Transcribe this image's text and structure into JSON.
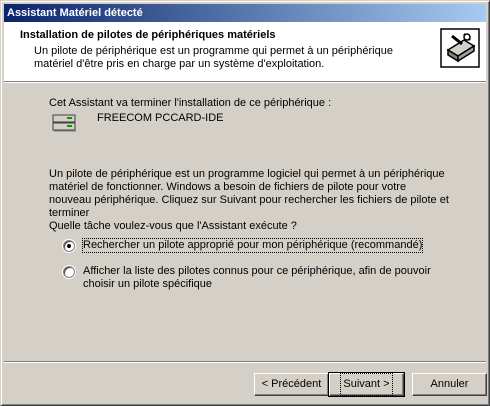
{
  "window": {
    "title": "Assistant Matériel détecté"
  },
  "header": {
    "title": "Installation de pilotes de périphériques matériels",
    "subtitle": "Un pilote de périphérique est un programme qui permet à un périphérique matériel d'être pris en charge par un système d'exploitation.",
    "icon": "hardware-wizard-icon"
  },
  "body": {
    "intro": "Cet Assistant va terminer l'installation de ce périphérique :",
    "device_name": "FREECOM PCCARD-IDE",
    "device_icon": "drive-card-icon",
    "description": "Un pilote de périphérique est un programme logiciel qui permet à un périphérique matériel de fonctionner. Windows a besoin de fichiers de pilote pour votre nouveau périphérique. Cliquez sur Suivant pour rechercher les fichiers de pilote et terminer",
    "question": "Quelle tâche voulez-vous que l'Assistant exécute ?",
    "options": [
      {
        "label": "Rechercher un pilote approprié pour mon périphérique (recommandé)",
        "checked": true
      },
      {
        "label": "Afficher la liste des pilotes connus pour ce périphérique, afin de pouvoir choisir un pilote spécifique",
        "checked": false
      }
    ]
  },
  "buttons": {
    "back": "< Précédent",
    "next": "Suivant >",
    "cancel": "Annuler"
  }
}
